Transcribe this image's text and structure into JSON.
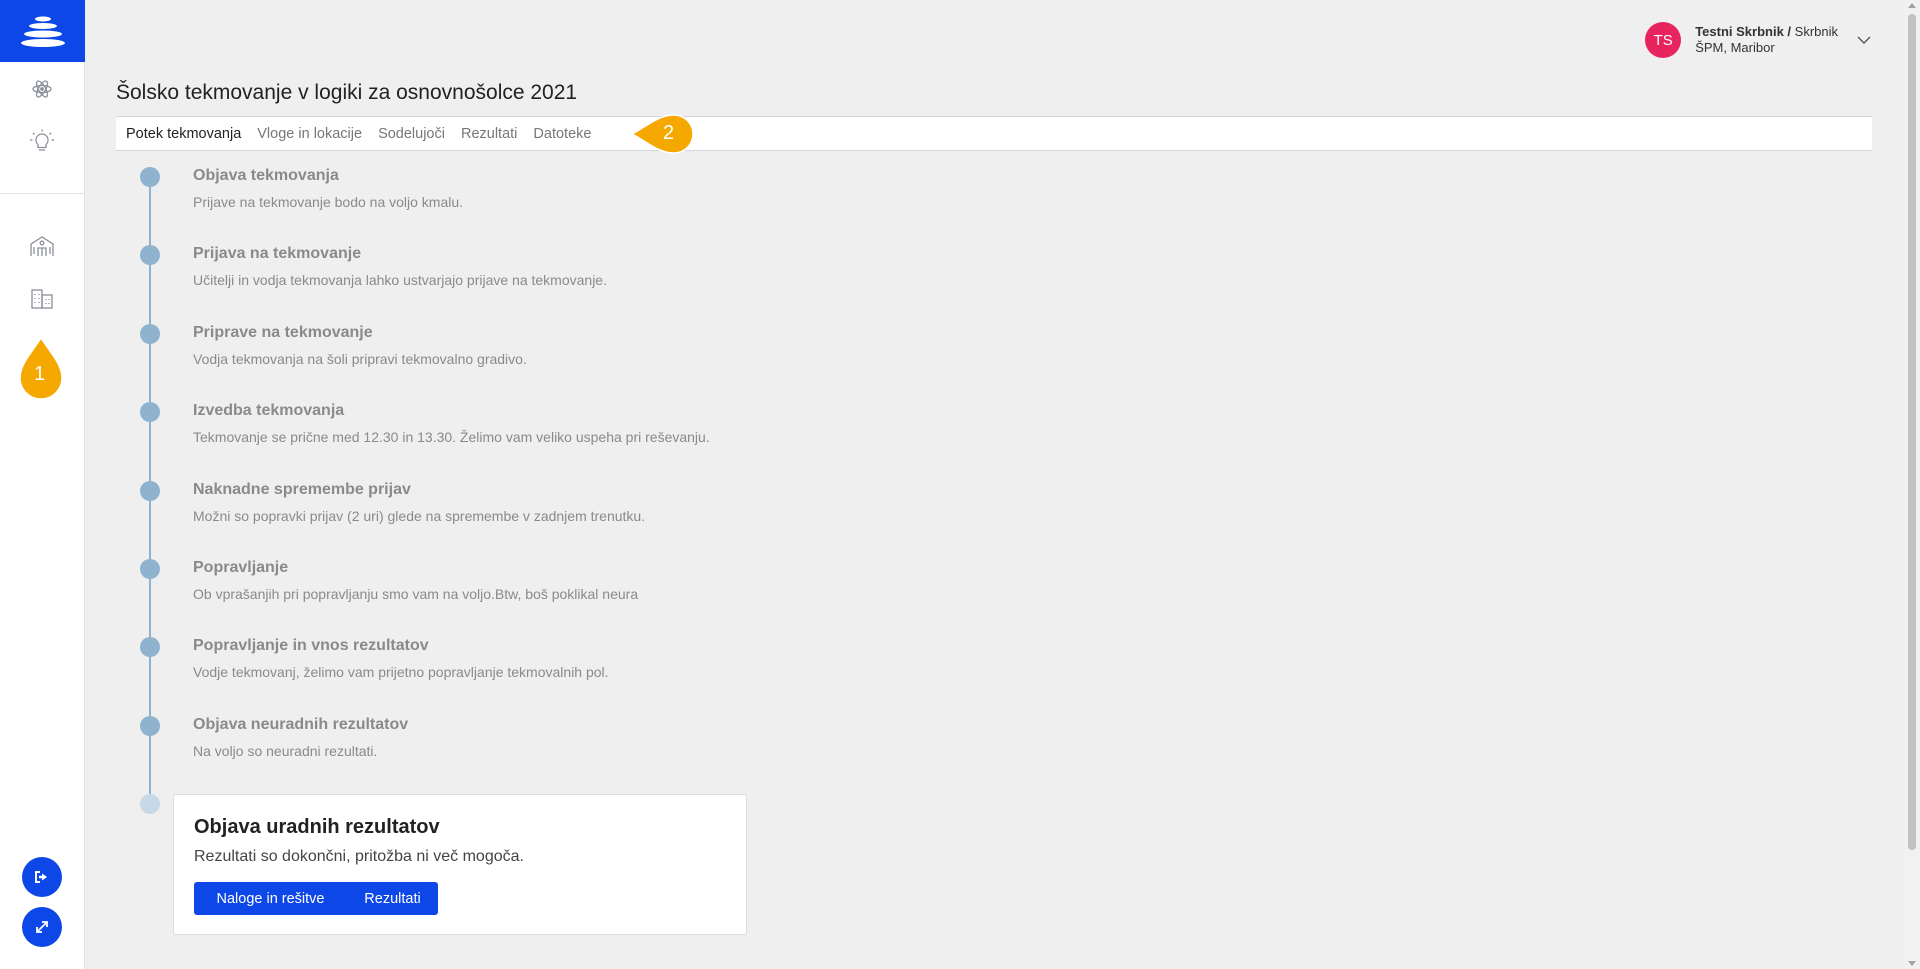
{
  "user": {
    "initials": "TS",
    "name": "Testni Skrbnik /",
    "role": " Skrbnik",
    "organization": "ŠPM, Maribor"
  },
  "page": {
    "title": "Šolsko tekmovanje v logiki za osnovnošolce 2021"
  },
  "tabs": [
    {
      "label": "Potek tekmovanja",
      "active": true
    },
    {
      "label": "Vloge in lokacije",
      "active": false
    },
    {
      "label": "Sodelujoči",
      "active": false
    },
    {
      "label": "Rezultati",
      "active": false
    },
    {
      "label": "Datoteke",
      "active": false
    }
  ],
  "markers": {
    "sidebar_marker": "1",
    "tabs_marker": "2"
  },
  "steps": [
    {
      "title": "Objava tekmovanja",
      "desc": "Prijave na tekmovanje bodo na voljo kmalu."
    },
    {
      "title": "Prijava na tekmovanje",
      "desc": "Učitelji in vodja tekmovanja lahko ustvarjajo prijave na tekmovanje."
    },
    {
      "title": "Priprave na tekmovanje",
      "desc": "Vodja tekmovanja na šoli pripravi tekmovalno gradivo."
    },
    {
      "title": "Izvedba tekmovanja",
      "desc": "Tekmovanje se prične med 12.30 in 13.30. Želimo vam veliko uspeha pri reševanju."
    },
    {
      "title": "Naknadne spremembe prijav",
      "desc": "Možni so popravki prijav (2 uri) glede na spremembe v zadnjem trenutku."
    },
    {
      "title": "Popravljanje",
      "desc": "Ob vprašanjih pri popravljanju smo vam na voljo.Btw, boš poklikal neura"
    },
    {
      "title": "Popravljanje in vnos rezultatov",
      "desc": "Vodje tekmovanj, želimo vam prijetno popravljanje tekmovalnih pol."
    },
    {
      "title": "Objava neuradnih rezultatov",
      "desc": "Na voljo so neuradni rezultati."
    }
  ],
  "final_step": {
    "title": "Objava uradnih rezultatov",
    "desc": "Rezultati so dokončni, pritožba ni več mogoča.",
    "button_tasks": "Naloge in rešitve",
    "button_results": "Rezultati"
  },
  "colors": {
    "accent": "#0d47e8",
    "avatar": "#e8245c",
    "marker": "#f5a800",
    "timeline": "#8fb3cf"
  },
  "icons": {
    "logo": "app-logo-icon",
    "sidebar": [
      "atom-icon",
      "lightbulb-icon",
      "school-icon",
      "buildings-icon"
    ],
    "bottom": [
      "logout-icon",
      "expand-icon"
    ]
  }
}
